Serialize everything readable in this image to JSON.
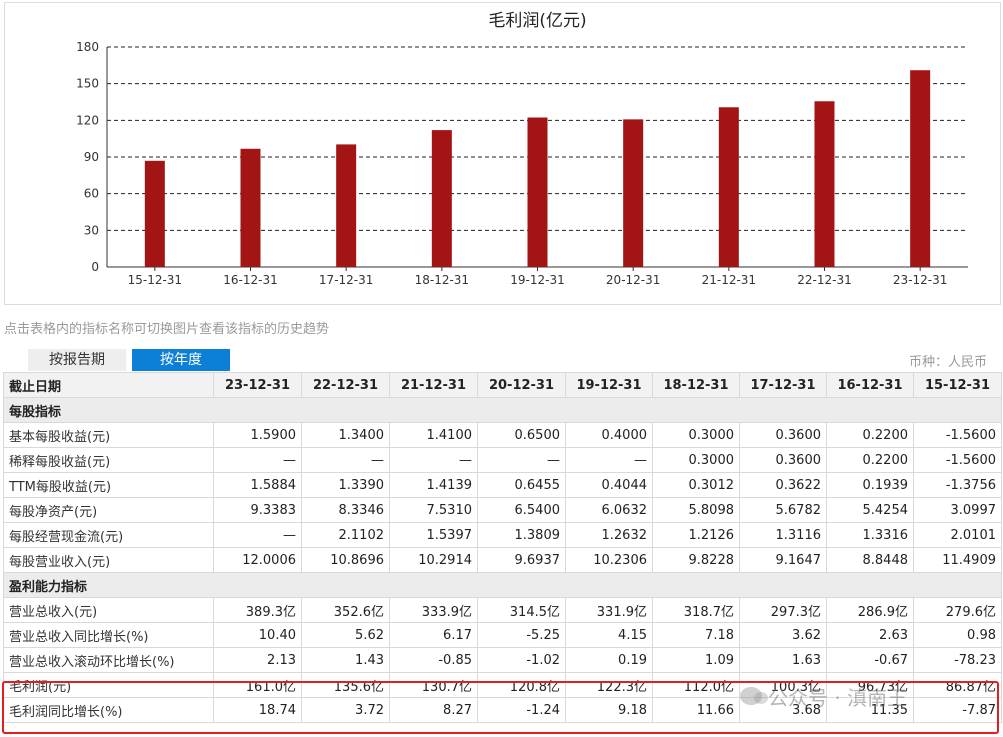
{
  "chart_data": {
    "type": "bar",
    "title": "毛利润(亿元)",
    "categories": [
      "15-12-31",
      "16-12-31",
      "17-12-31",
      "18-12-31",
      "19-12-31",
      "20-12-31",
      "21-12-31",
      "22-12-31",
      "23-12-31"
    ],
    "values": [
      86.87,
      96.73,
      100.3,
      112.0,
      122.3,
      120.8,
      130.7,
      135.6,
      161.0
    ],
    "ylim": [
      0,
      180
    ],
    "yticks": [
      "0",
      "30",
      "60",
      "90",
      "120",
      "150",
      "180"
    ],
    "grid": "dashed horizontal",
    "bar_color": "#a31515"
  },
  "hint_text": "点击表格内的指标名称可切换图片查看该指标的历史趋势",
  "tabs": {
    "by_report": "按报告期",
    "by_year": "按年度"
  },
  "currency": "币种：人民币",
  "table": {
    "header_label": "截止日期",
    "periods": [
      "23-12-31",
      "22-12-31",
      "21-12-31",
      "20-12-31",
      "19-12-31",
      "18-12-31",
      "17-12-31",
      "16-12-31",
      "15-12-31"
    ],
    "rows": [
      {
        "section": "每股指标"
      },
      {
        "label": "基本每股收益(元)",
        "values": [
          "1.5900",
          "1.3400",
          "1.4100",
          "0.6500",
          "0.4000",
          "0.3000",
          "0.3600",
          "0.2200",
          "-1.5600"
        ]
      },
      {
        "label": "稀释每股收益(元)",
        "values": [
          "—",
          "—",
          "—",
          "—",
          "—",
          "0.3000",
          "0.3600",
          "0.2200",
          "-1.5600"
        ]
      },
      {
        "label": "TTM每股收益(元)",
        "values": [
          "1.5884",
          "1.3390",
          "1.4139",
          "0.6455",
          "0.4044",
          "0.3012",
          "0.3622",
          "0.1939",
          "-1.3756"
        ]
      },
      {
        "label": "每股净资产(元)",
        "values": [
          "9.3383",
          "8.3346",
          "7.5310",
          "6.5400",
          "6.0632",
          "5.8098",
          "5.6782",
          "5.4254",
          "3.0997"
        ]
      },
      {
        "label": "每股经营现金流(元)",
        "values": [
          "—",
          "2.1102",
          "1.5397",
          "1.3809",
          "1.2632",
          "1.2126",
          "1.3116",
          "1.3316",
          "2.0101"
        ]
      },
      {
        "label": "每股营业收入(元)",
        "values": [
          "12.0006",
          "10.8696",
          "10.2914",
          "9.6937",
          "10.2306",
          "9.8228",
          "9.1647",
          "8.8448",
          "11.4909"
        ]
      },
      {
        "section": "盈利能力指标"
      },
      {
        "label": "营业总收入(元)",
        "values": [
          "389.3亿",
          "352.6亿",
          "333.9亿",
          "314.5亿",
          "331.9亿",
          "318.7亿",
          "297.3亿",
          "286.9亿",
          "279.6亿"
        ]
      },
      {
        "label": "营业总收入同比增长(%)",
        "values": [
          "10.40",
          "5.62",
          "6.17",
          "-5.25",
          "4.15",
          "7.18",
          "3.62",
          "2.63",
          "0.98"
        ]
      },
      {
        "label": "营业总收入滚动环比增长(%)",
        "values": [
          "2.13",
          "1.43",
          "-0.85",
          "-1.02",
          "0.19",
          "1.09",
          "1.63",
          "-0.67",
          "-78.23"
        ]
      },
      {
        "label": "毛利润(元)",
        "values": [
          "161.0亿",
          "135.6亿",
          "130.7亿",
          "120.8亿",
          "122.3亿",
          "112.0亿",
          "100.3亿",
          "96.73亿",
          "86.87亿"
        ]
      },
      {
        "label": "毛利润同比增长(%)",
        "values": [
          "18.74",
          "3.72",
          "8.27",
          "-1.24",
          "9.18",
          "11.66",
          "3.68",
          "11.35",
          "-7.87"
        ]
      }
    ]
  },
  "watermark": "公众号 · 滇南王"
}
